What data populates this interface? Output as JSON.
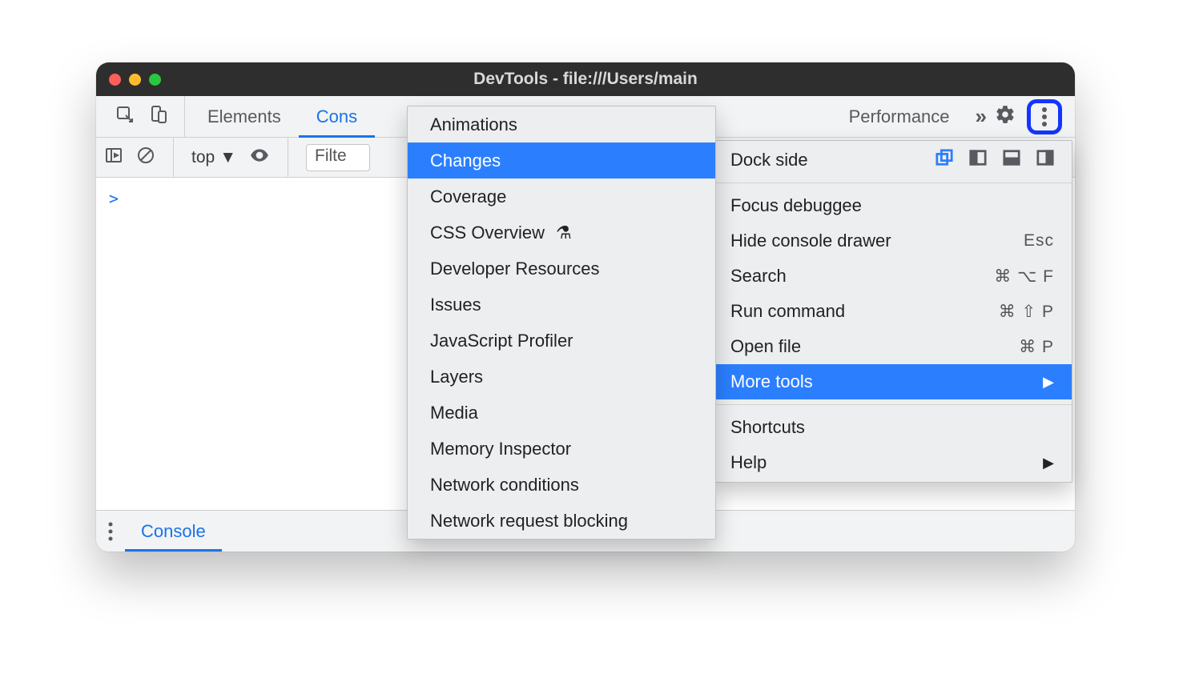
{
  "title": "DevTools - file:///Users/main",
  "tabs": {
    "elements": "Elements",
    "console_trunc": "Cons",
    "performance_trunc": "Performance",
    "overflow_glyph": "»"
  },
  "toolbar": {
    "context": "top",
    "filter_placeholder": "Filte"
  },
  "console": {
    "prompt": ">"
  },
  "drawer": {
    "tab": "Console"
  },
  "menu": {
    "dock_side": "Dock side",
    "focus_debuggee": "Focus debuggee",
    "hide_drawer": "Hide console drawer",
    "hide_drawer_short": "Esc",
    "search": "Search",
    "search_short": "⌘ ⌥ F",
    "run_command": "Run command",
    "run_command_short": "⌘ ⇧ P",
    "open_file": "Open file",
    "open_file_short": "⌘ P",
    "more_tools": "More tools",
    "shortcuts": "Shortcuts",
    "help": "Help"
  },
  "submenu": {
    "items": [
      "Animations",
      "Changes",
      "Coverage",
      "CSS Overview",
      "Developer Resources",
      "Issues",
      "JavaScript Profiler",
      "Layers",
      "Media",
      "Memory Inspector",
      "Network conditions",
      "Network request blocking"
    ],
    "experiment_glyph": "⚗"
  },
  "colors": {
    "accent": "#2b7fff",
    "ring": "#1435ff"
  }
}
